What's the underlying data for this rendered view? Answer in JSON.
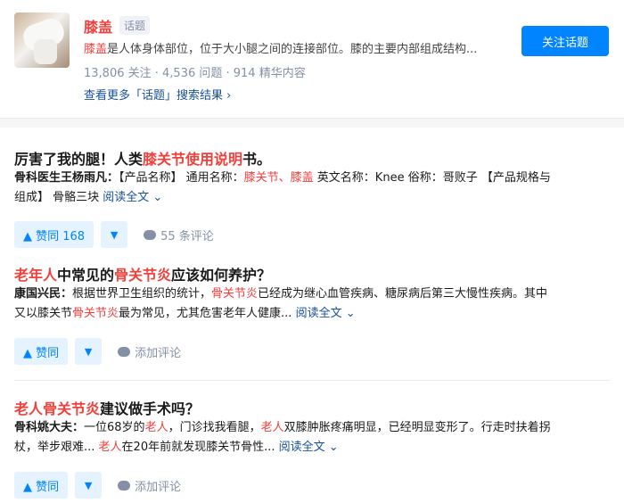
{
  "topic": {
    "name": "膝盖",
    "tag": "话题",
    "desc_hl": "膝盖",
    "desc_rest": "是人体身体部位，位于大小腿之间的连接部位。膝的主要内部组成结构...",
    "stats": "13,806 关注 · 4,536 问题 · 914 精华内容",
    "more_link": "查看更多「话题」搜索结果 ›",
    "follow_label": "关注话题"
  },
  "answers": [
    {
      "title_parts": [
        "厉害了我的腿！人类",
        "膝关节使用说明",
        "书。"
      ],
      "author": "骨科医生王杨雨凡：",
      "excerpt_line1_a": "【产品名称】 通用名称：",
      "excerpt_line1_hl": "膝关节、膝盖",
      "excerpt_line1_b": " 英文名称：Knee 俗称：哥败子 【产品规格与",
      "excerpt_line2": "组成】 骨骼三块 ",
      "read_more": "阅读全文 ⌄",
      "vote_label": "▲ 赞同 168",
      "comment_label": "55 条评论"
    },
    {
      "title_parts": [
        "老年人",
        "中常见的",
        "骨关节炎",
        "应该如何养护？"
      ],
      "author": "康国兴民：",
      "excerpt_line1_a": "根据世界卫生组织的统计，",
      "excerpt_line1_hl": "骨关节炎",
      "excerpt_line1_b": "已经成为继心血管疾病、糖尿病后第三大慢性疾病。其中",
      "excerpt_line2_a": "又以膝关节",
      "excerpt_line2_hl": "骨关节炎",
      "excerpt_line2_b": "最为常见，尤其危害老年人健康... ",
      "read_more": "阅读全文 ⌄",
      "vote_label": "▲ 赞同",
      "comment_label": "添加评论"
    },
    {
      "title_parts": [
        "老人",
        "骨关节炎",
        "建议做手术吗？"
      ],
      "author": "骨科姚大夫：",
      "excerpt_line1_a": "一位68岁的",
      "excerpt_line1_hl": "老人",
      "excerpt_line1_b": "，门诊找我看腿，",
      "excerpt_line1_hl2": "老人",
      "excerpt_line1_c": "双膝肿胀疼痛明显，已经明显变形了。行走时扶着拐",
      "excerpt_line2_a": "杖，举步艰难... ",
      "excerpt_line2_hl": "老人",
      "excerpt_line2_b": "在20年前就发现膝关节骨性... ",
      "read_more": "阅读全文 ⌄",
      "vote_label": "▲ 赞同",
      "comment_label": "添加评论"
    }
  ],
  "vote_down_label": "▼"
}
